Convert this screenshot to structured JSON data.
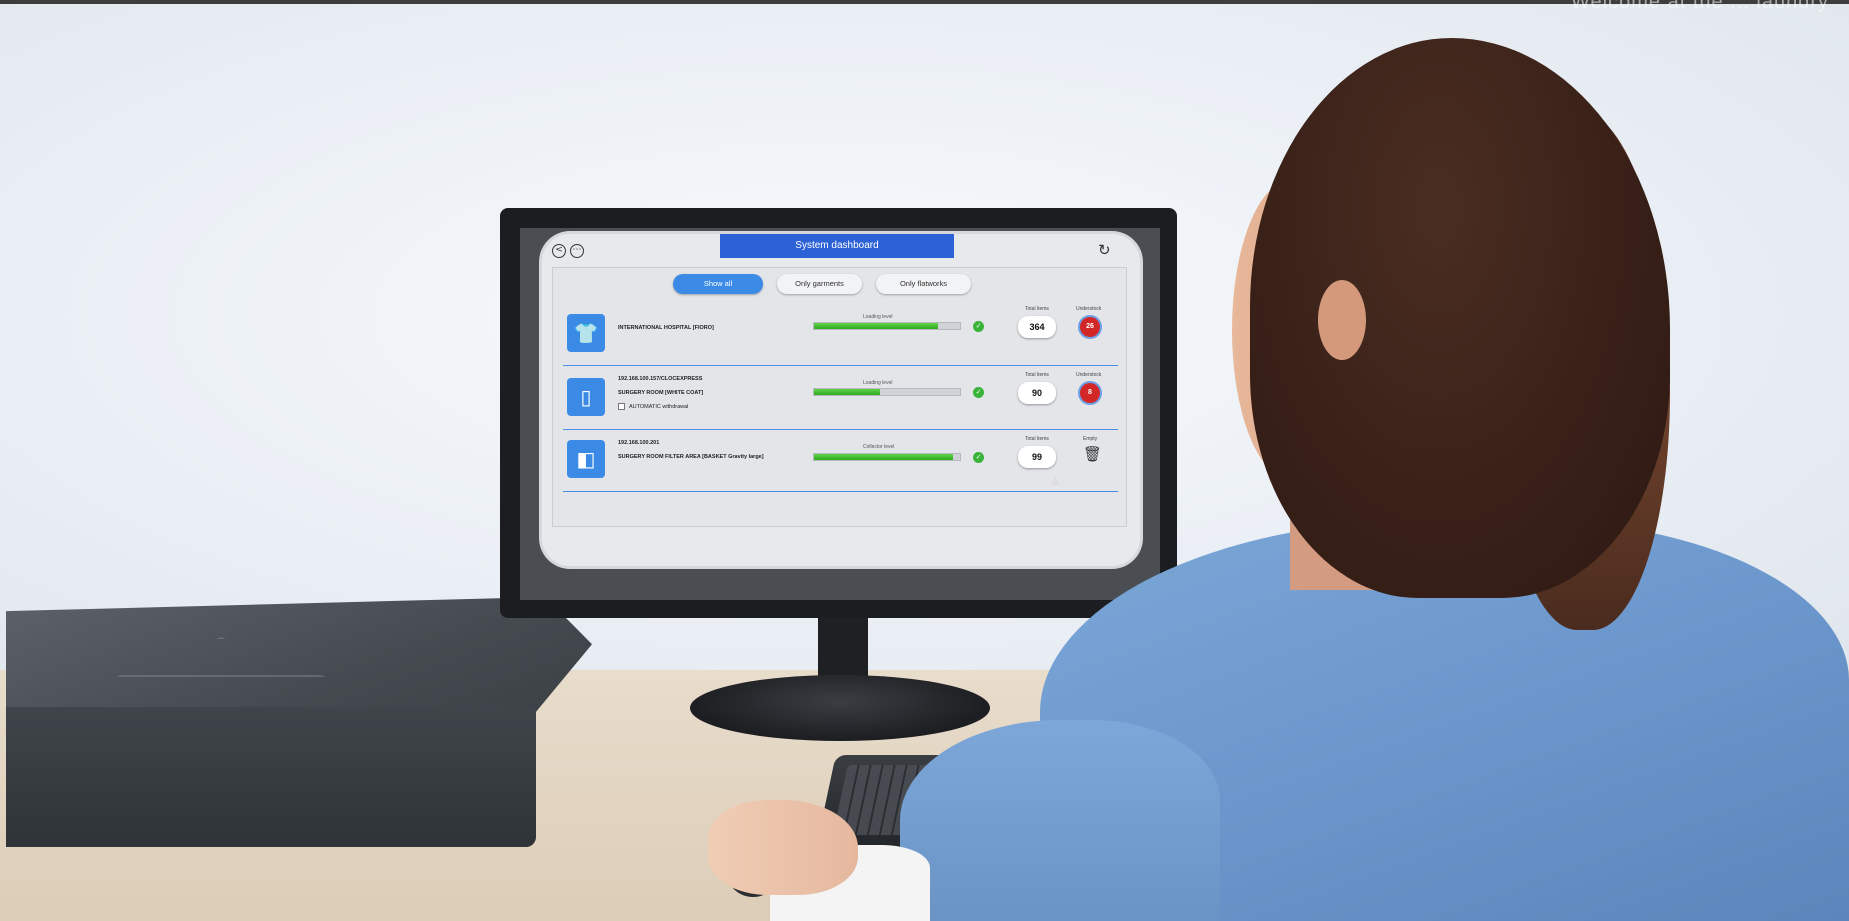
{
  "page": {
    "overlay_text": "Welcome at the ... laundry"
  },
  "dashboard": {
    "title": "System dashboard",
    "filters": [
      "Show all",
      "Only garments",
      "Only flatworks"
    ],
    "active_filter": 0,
    "rows": [
      {
        "name_line1": "INTERNATIONAL HOSPITAL [FIORO]",
        "name_line2": "",
        "checkbox_label": "",
        "level_label": "Loading level",
        "level": 0.85,
        "count_label": "Total items",
        "count": "364",
        "status_label": "Understock",
        "status_value": "26",
        "status_type": "badge",
        "icon": "garment-icon"
      },
      {
        "name_line1": "192.168.100.157/CLOCEXPRESS",
        "name_line2": "SURGERY ROOM [WHITE COAT]",
        "checkbox_label": "AUTOMATIC withdrawal",
        "level_label": "Loading level",
        "level": 0.45,
        "count_label": "Total items",
        "count": "90",
        "status_label": "Understock",
        "status_value": "8",
        "status_type": "badge",
        "icon": "cabinet-icon"
      },
      {
        "name_line1": "192.168.100.201",
        "name_line2": "SURGERY ROOM FILTER AREA [BASKET Gravity large]",
        "checkbox_label": "",
        "level_label": "Collector level",
        "level": 0.95,
        "count_label": "Total items",
        "count": "99",
        "status_label": "Empty",
        "status_value": "",
        "status_type": "trash",
        "icon": "collector-icon"
      }
    ]
  }
}
